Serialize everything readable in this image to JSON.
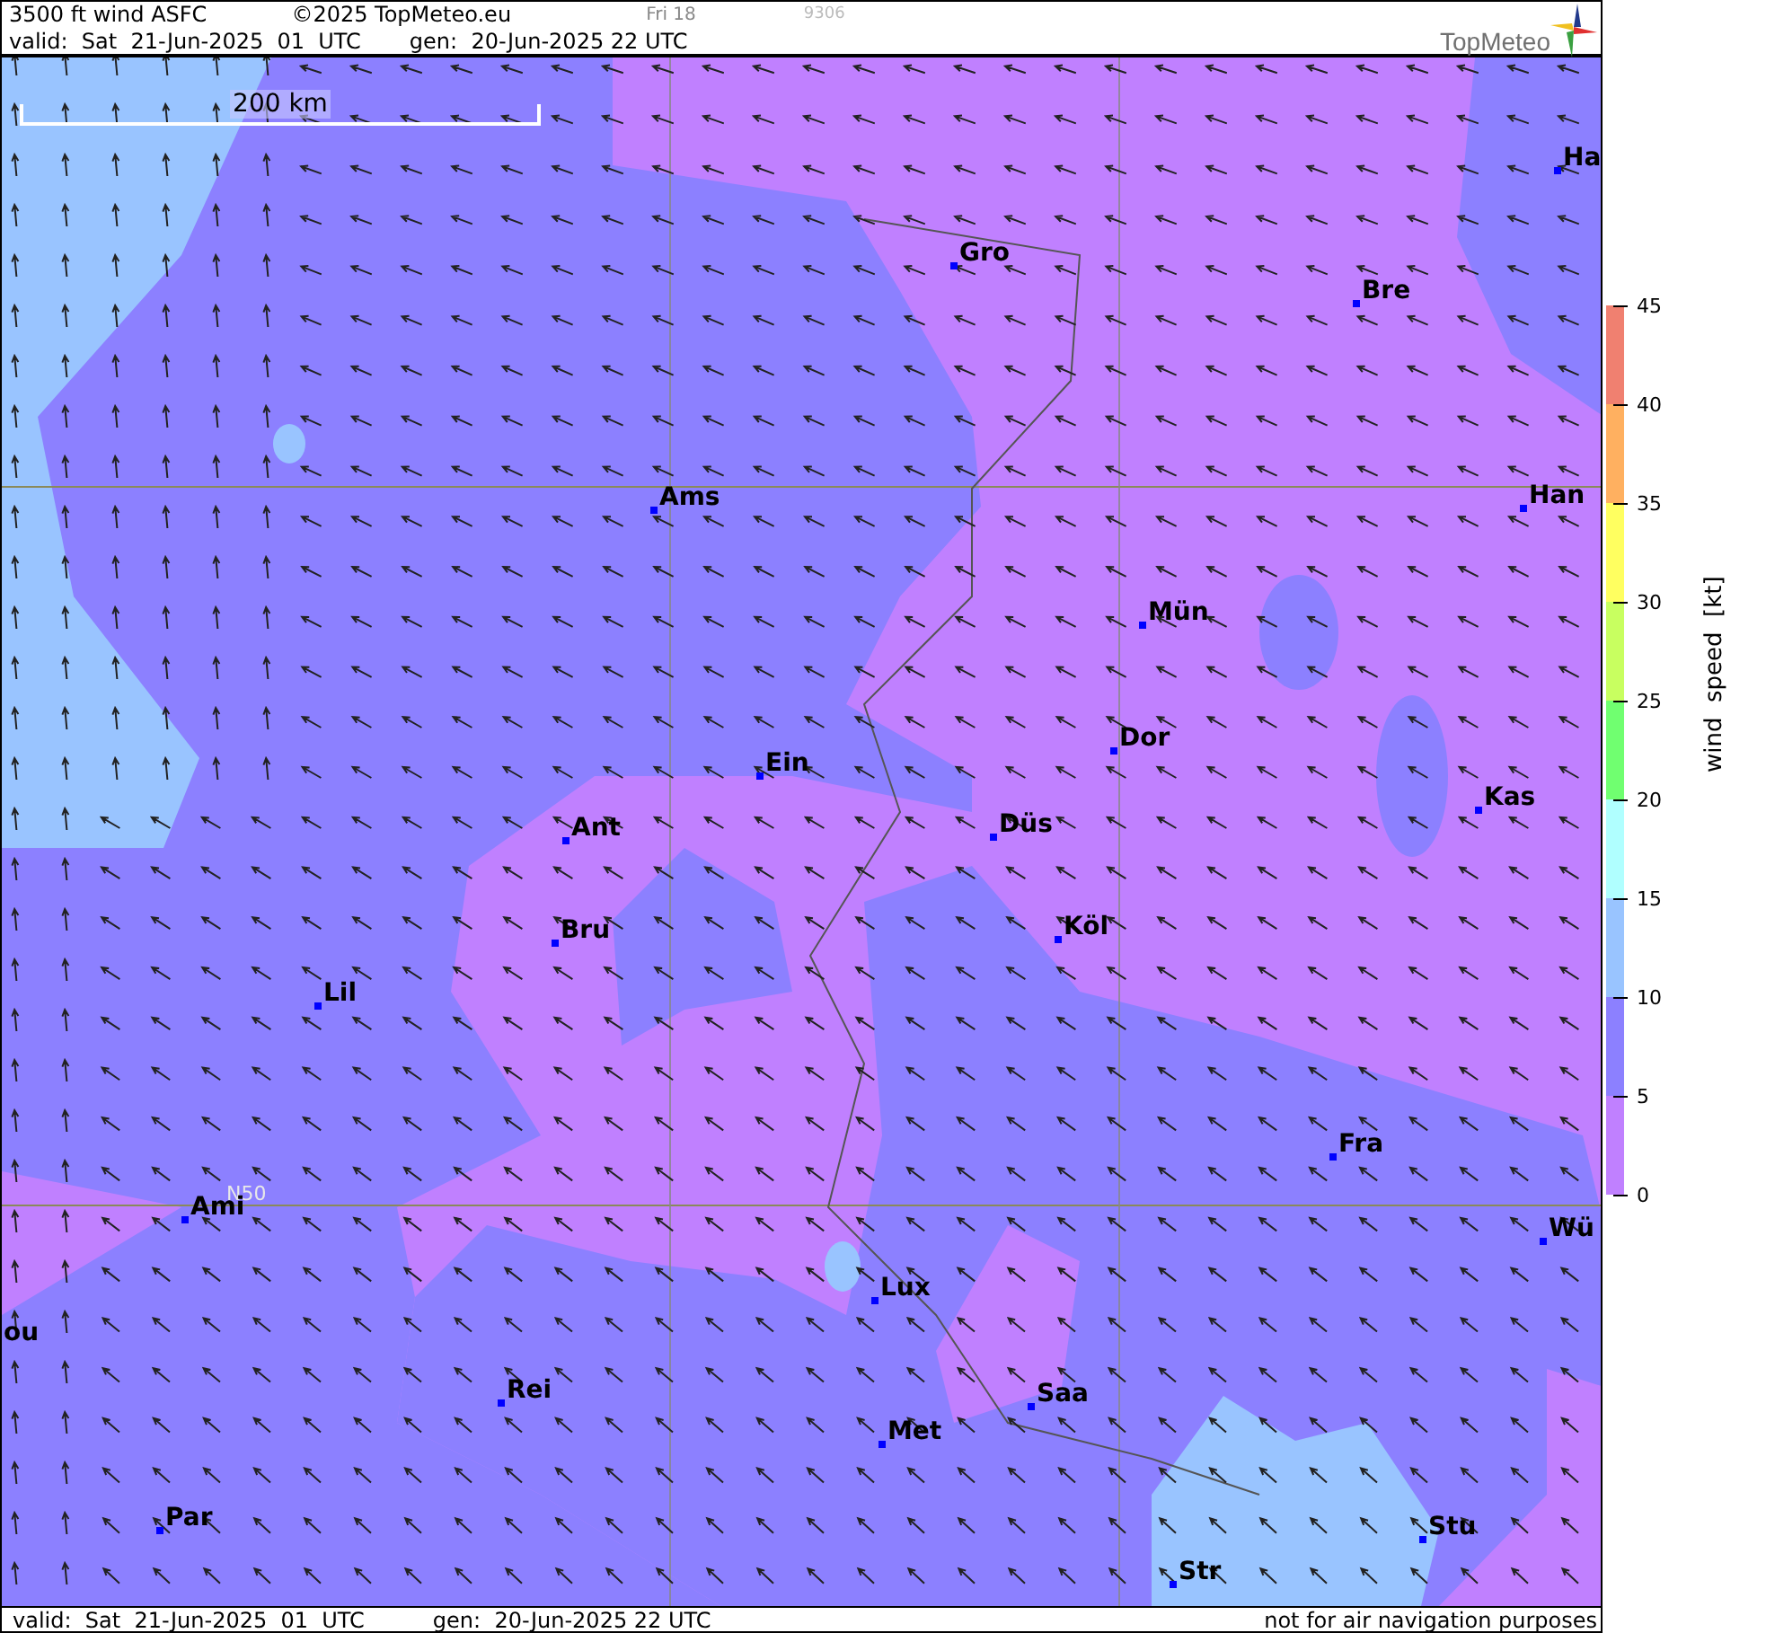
{
  "header": {
    "title": "3500 ft wind ASFC",
    "copyright": "©2025 TopMeteo.eu",
    "day": "Fri 18",
    "code": "9306",
    "valid": "valid:  Sat  21-Jun-2025  01  UTC",
    "gen": "gen:  20-Jun-2025 22 UTC"
  },
  "logo": {
    "text": "TopMeteo"
  },
  "map": {
    "scale_label": "200 km",
    "grid_label": "N50",
    "cities": [
      {
        "name": "Ha"
      },
      {
        "name": "Gro"
      },
      {
        "name": "Bre"
      },
      {
        "name": "Ams"
      },
      {
        "name": "Han"
      },
      {
        "name": "Mün"
      },
      {
        "name": "Dor"
      },
      {
        "name": "Ein"
      },
      {
        "name": "Kas"
      },
      {
        "name": "Düs"
      },
      {
        "name": "Ant"
      },
      {
        "name": "Bru"
      },
      {
        "name": "Köl"
      },
      {
        "name": "Lil"
      },
      {
        "name": "Fra"
      },
      {
        "name": "Ami"
      },
      {
        "name": "Wü"
      },
      {
        "name": "Lux"
      },
      {
        "name": "ou"
      },
      {
        "name": "Rei"
      },
      {
        "name": "Saa"
      },
      {
        "name": "Met"
      },
      {
        "name": "Par"
      },
      {
        "name": "Stu"
      },
      {
        "name": "Str"
      }
    ]
  },
  "legend": {
    "label": "wind  speed  [kt]",
    "ticks": [
      "45",
      "40",
      "35",
      "30",
      "25",
      "20",
      "15",
      "10",
      "5",
      "0"
    ],
    "bands": [
      {
        "color": "#f08070"
      },
      {
        "color": "#ffb060"
      },
      {
        "color": "#ffff60"
      },
      {
        "color": "#c8ff60"
      },
      {
        "color": "#70ff70"
      },
      {
        "color": "#b0ffff"
      },
      {
        "color": "#99c4ff"
      },
      {
        "color": "#8c80ff"
      },
      {
        "color": "#c080ff"
      }
    ]
  },
  "footer": {
    "valid": "valid:  Sat  21-Jun-2025  01  UTC",
    "gen": "gen:  20-Jun-2025 22 UTC",
    "disclaimer": "not for air navigation purposes"
  }
}
